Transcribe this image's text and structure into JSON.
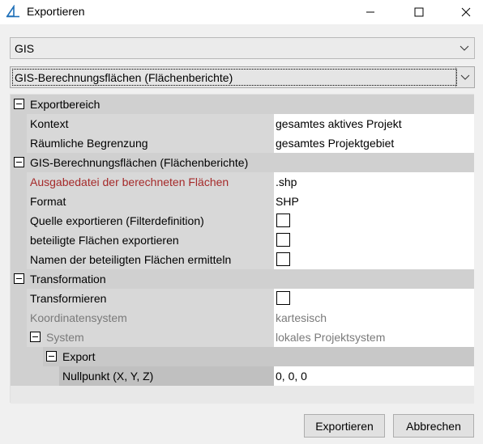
{
  "window": {
    "title": "Exportieren",
    "minimize_icon": "minimize-icon",
    "maximize_icon": "maximize-icon",
    "close_icon": "close-icon"
  },
  "dropdowns": {
    "category": "GIS",
    "subtype": "GIS-Berechnungsflächen (Flächenberichte)"
  },
  "grid": {
    "cat_export": "Exportbereich",
    "kontext_label": "Kontext",
    "kontext_value": "gesamtes aktives Projekt",
    "begrenzung_label": "Räumliche Begrenzung",
    "begrenzung_value": "gesamtes Projektgebiet",
    "cat_gis": "GIS-Berechnungsflächen (Flächenberichte)",
    "ausgabe_label": "Ausgabedatei der berechneten Flächen",
    "ausgabe_value": ".shp",
    "format_label": "Format",
    "format_value": "SHP",
    "quelle_label": "Quelle exportieren (Filterdefinition)",
    "beteiligt_label": "beteiligte Flächen exportieren",
    "namen_label": "Namen der beteiligten Flächen ermitteln",
    "cat_trans": "Transformation",
    "transformieren_label": "Transformieren",
    "koord_label": "Koordinatensystem",
    "koord_value": "kartesisch",
    "system_label": "System",
    "system_value": "lokales Projektsystem",
    "export_label": "Export",
    "nullpunkt_label": "Nullpunkt (X, Y, Z)",
    "nullpunkt_value": "0, 0, 0"
  },
  "buttons": {
    "export": "Exportieren",
    "cancel": "Abbrechen"
  },
  "colors": {
    "accent_icon": "#1e6fb8",
    "error_label": "#a52a2a"
  }
}
